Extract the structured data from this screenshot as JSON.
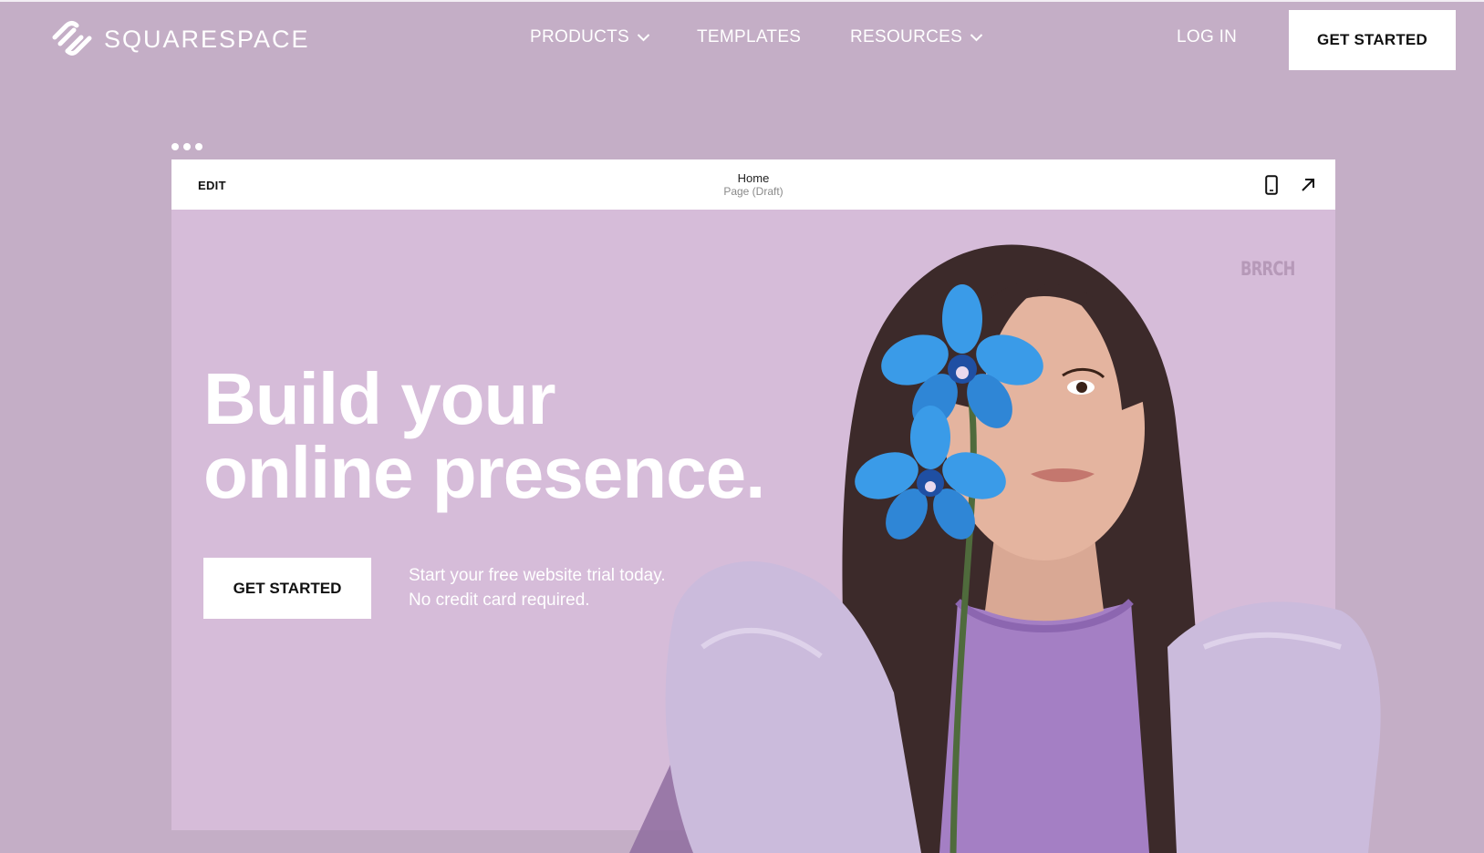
{
  "brand": {
    "name": "SQUARESPACE",
    "logo_icon": "squarespace-logo-icon"
  },
  "nav": {
    "items": [
      {
        "label": "PRODUCTS",
        "has_dropdown": true
      },
      {
        "label": "TEMPLATES",
        "has_dropdown": false
      },
      {
        "label": "RESOURCES",
        "has_dropdown": true
      }
    ],
    "login_label": "LOG IN",
    "cta_label": "GET STARTED"
  },
  "editor": {
    "edit_label": "EDIT",
    "page_title": "Home",
    "page_status": "Page (Draft)",
    "mobile_icon": "mobile-preview-icon",
    "open_icon": "open-external-arrow-icon"
  },
  "hero": {
    "brand_mark": "BRRCH",
    "title_line1": "Build your",
    "title_line2": "online presence.",
    "cta_label": "GET STARTED",
    "sub_line1": "Start your free website trial today.",
    "sub_line2": "No credit card required."
  },
  "colors": {
    "page_background": "#c4aec6",
    "frame_background": "#d6bcd9",
    "orchid_blue": "#3a9be8",
    "sweater_purple": "#a47fc4",
    "text_white": "#ffffff",
    "button_text": "#111111"
  }
}
